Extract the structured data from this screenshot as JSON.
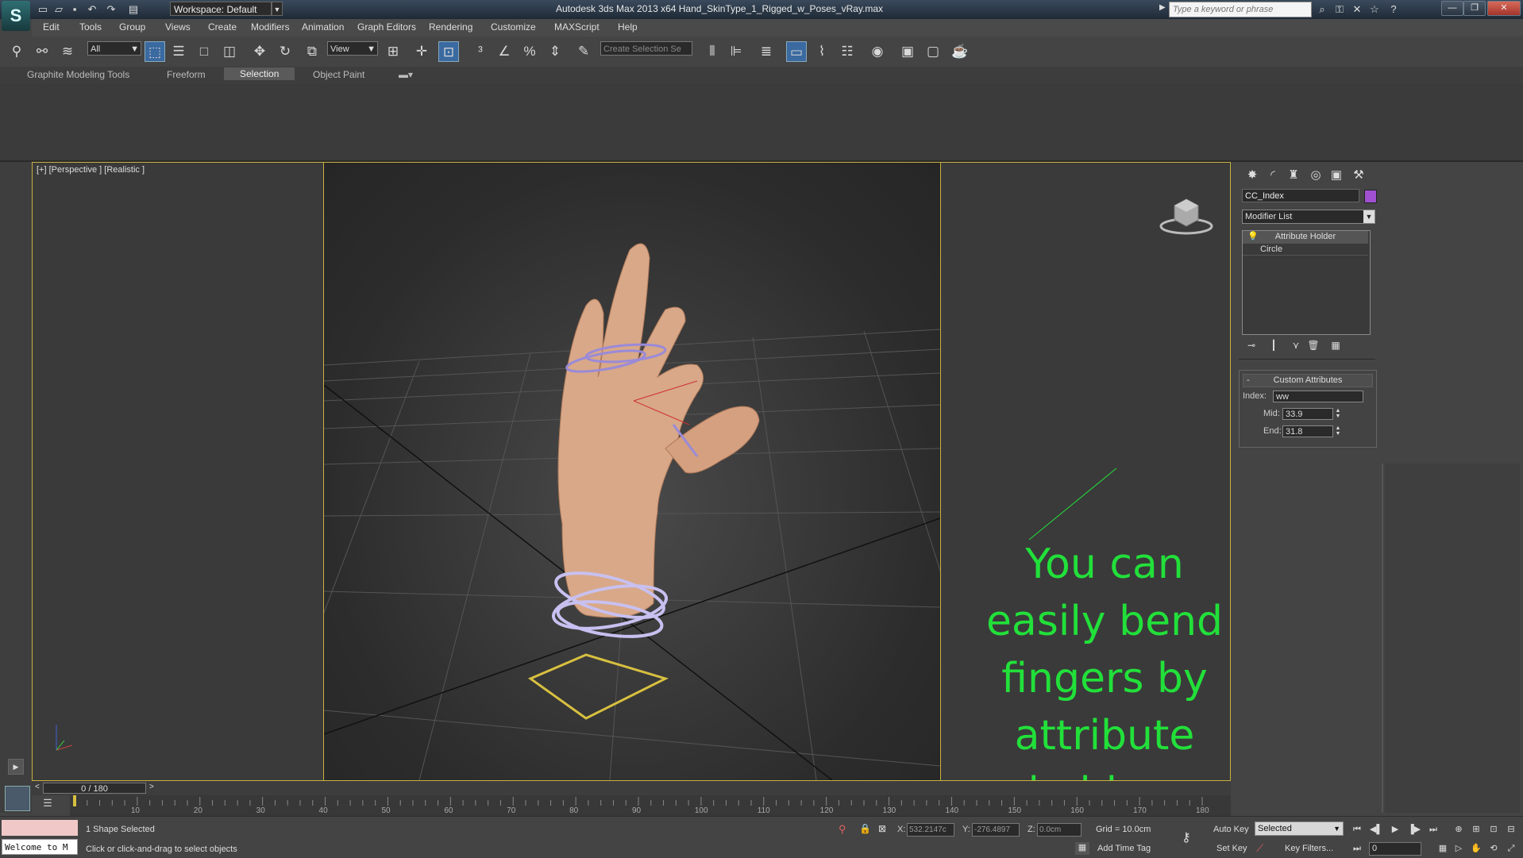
{
  "titlebar": {
    "workspace": "Workspace: Default",
    "title": "Autodesk 3ds Max  2013 x64     Hand_SkinType_1_Rigged_w_Poses_vRay.max",
    "search_placeholder": "Type a keyword or phrase"
  },
  "menu": [
    "Edit",
    "Tools",
    "Group",
    "Views",
    "Create",
    "Modifiers",
    "Animation",
    "Graph Editors",
    "Rendering",
    "Customize",
    "MAXScript",
    "Help"
  ],
  "toolbar": {
    "selection_filter": "All",
    "reference_coord": "View",
    "named_selection_placeholder": "Create Selection Se"
  },
  "ribbon": {
    "tabs": [
      "Graphite Modeling Tools",
      "Freeform",
      "Selection",
      "Object Paint"
    ],
    "active_tab": "Selection"
  },
  "viewport": {
    "label": "[+] [Perspective ] [Realistic ]",
    "annotation_lines": [
      "You can easily bend",
      "fingers by attribute",
      "holders"
    ]
  },
  "command_panel": {
    "object_name": "CC_Index",
    "object_color": "#a050d0",
    "modifier_list": "Modifier List",
    "stack": [
      "Attribute Holder",
      "Circle"
    ],
    "rollout_title": "Custom Attributes",
    "index_label": "Index:",
    "index_value": "ww",
    "mid_label": "Mid:",
    "mid_value": "33.9",
    "end_label": "End:",
    "end_value": "31.8"
  },
  "timeline": {
    "slider": "0 / 180",
    "ticks": [
      "10",
      "20",
      "30",
      "40",
      "50",
      "60",
      "70",
      "80",
      "90",
      "100",
      "110",
      "120",
      "130",
      "140",
      "150",
      "160",
      "170",
      "180"
    ]
  },
  "status": {
    "listener": "Welcome to M",
    "selection": "1 Shape Selected",
    "prompt": "Click or click-and-drag to select objects",
    "x_label": "X:",
    "x_value": "532.2147c",
    "y_label": "Y:",
    "y_value": "-276.4897",
    "z_label": "Z:",
    "z_value": "0.0cm",
    "grid": "Grid = 10.0cm",
    "add_time_tag": "Add Time Tag",
    "auto_key": "Auto Key",
    "set_key": "Set Key",
    "selected": "Selected",
    "key_filters": "Key Filters...",
    "frame": "0"
  },
  "colors": {
    "annotation": "#22e03a",
    "viewport_border": "#c8b040"
  }
}
